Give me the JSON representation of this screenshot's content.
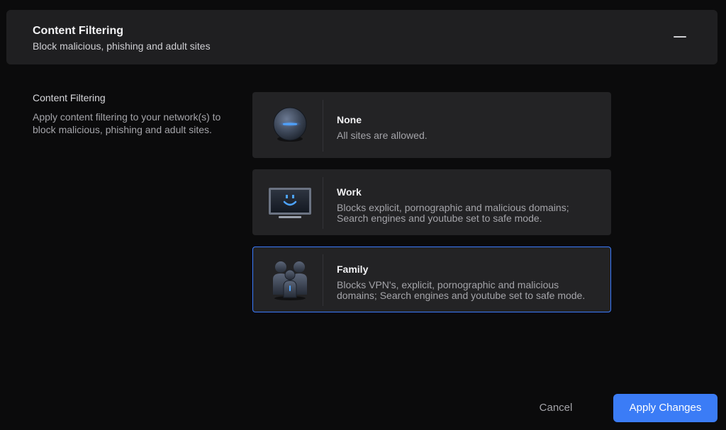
{
  "header": {
    "title": "Content Filtering",
    "subtitle": "Block malicious, phishing and adult sites",
    "collapse_icon": "minus-icon"
  },
  "section": {
    "title": "Content Filtering",
    "description": "Apply content filtering to your network(s) to block malicious, phishing and adult sites."
  },
  "options": [
    {
      "title": "None",
      "description": "All sites are allowed.",
      "icon": "none-orb-icon",
      "selected": false
    },
    {
      "title": "Work",
      "description": "Blocks explicit, pornographic and malicious domains; Search engines and youtube set to safe mode.",
      "icon": "monitor-smiley-icon",
      "selected": false
    },
    {
      "title": "Family",
      "description": "Blocks VPN's, explicit, pornographic and malicious domains; Search engines and youtube set to safe mode.",
      "icon": "family-group-icon",
      "selected": true
    }
  ],
  "footer": {
    "cancel_label": "Cancel",
    "apply_label": "Apply Changes"
  },
  "colors": {
    "accent": "#3b7cf6",
    "selected_border": "#3a7bff",
    "panel": "#232325",
    "background": "#0b0b0c"
  }
}
